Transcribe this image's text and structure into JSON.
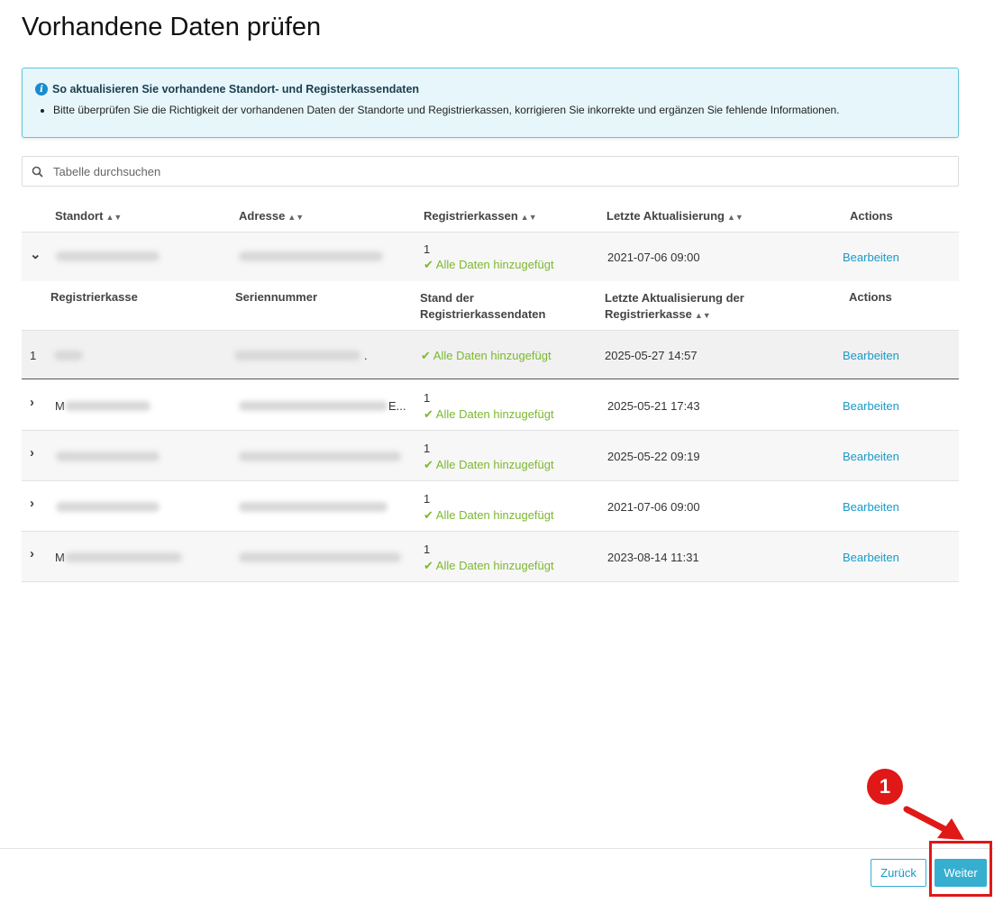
{
  "page": {
    "title": "Vorhandene Daten prüfen"
  },
  "info": {
    "title": "So aktualisieren Sie vorhandene Standort- und Registerkassendaten",
    "items": [
      "Bitte überprüfen Sie die Richtigkeit der vorhandenen Daten der Standorte und Registrierkassen, korrigieren Sie inkorrekte und ergänzen Sie fehlende Informationen."
    ]
  },
  "search": {
    "placeholder": "Tabelle durchsuchen"
  },
  "table": {
    "headers": {
      "standort": "Standort",
      "adresse": "Adresse",
      "registrierkassen": "Registrierkassen",
      "letzte": "Letzte Aktualisierung",
      "actions": "Actions"
    },
    "rows": [
      {
        "count": "1",
        "status": "Alle Daten hinzugefügt",
        "updated": "2021-07-06 09:00",
        "action": "Bearbeiten",
        "name_prefix": "",
        "addr_suffix": ""
      },
      {
        "count": "1",
        "status": "Alle Daten hinzugefügt",
        "updated": "2025-05-21 17:43",
        "action": "Bearbeiten",
        "name_prefix": "M",
        "addr_suffix": "E..."
      },
      {
        "count": "1",
        "status": "Alle Daten hinzugefügt",
        "updated": "2025-05-22 09:19",
        "action": "Bearbeiten",
        "name_prefix": "",
        "addr_suffix": ""
      },
      {
        "count": "1",
        "status": "Alle Daten hinzugefügt",
        "updated": "2021-07-06 09:00",
        "action": "Bearbeiten",
        "name_prefix": "",
        "addr_suffix": ""
      },
      {
        "count": "1",
        "status": "Alle Daten hinzugefügt",
        "updated": "2023-08-14 11:31",
        "action": "Bearbeiten",
        "name_prefix": "M",
        "addr_suffix": ""
      }
    ]
  },
  "subtable": {
    "headers": {
      "registrierkasse": "Registrierkasse",
      "seriennummer": "Seriennummer",
      "stand_line1": "Stand der",
      "stand_line2": "Registrierkassendaten",
      "letzte_line1": "Letzte Aktualisierung der",
      "letzte_line2": "Registrierkasse",
      "actions": "Actions"
    },
    "rows": [
      {
        "index": "1",
        "serial_suffix": ".",
        "status": "Alle Daten hinzugefügt",
        "updated": "2025-05-27 14:57",
        "action": "Bearbeiten"
      }
    ]
  },
  "footer": {
    "back_label": "Zurück",
    "next_label": "Weiter"
  },
  "annotation": {
    "step": "1"
  },
  "colors": {
    "accent": "#36aed0",
    "success": "#7cb82f",
    "highlight": "#e01818",
    "info_bg": "#e6f6fb"
  }
}
